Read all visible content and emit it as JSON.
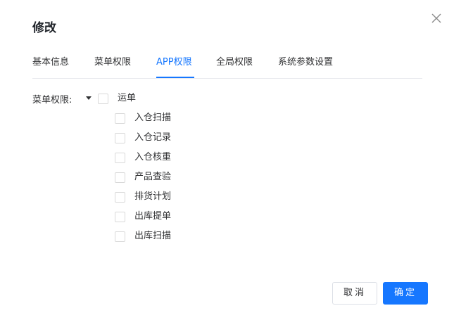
{
  "dialog": {
    "title": "修改"
  },
  "tabs": [
    {
      "label": "基本信息",
      "active": false
    },
    {
      "label": "菜单权限",
      "active": false
    },
    {
      "label": "APP权限",
      "active": true
    },
    {
      "label": "全局权限",
      "active": false
    },
    {
      "label": "系统参数设置",
      "active": false
    }
  ],
  "form": {
    "label": "菜单权限:",
    "tree": {
      "parent": {
        "label": "运单",
        "checked": false,
        "expanded": true
      },
      "children": [
        {
          "label": "入仓扫描",
          "checked": false
        },
        {
          "label": "入仓记录",
          "checked": false
        },
        {
          "label": "入仓核重",
          "checked": false
        },
        {
          "label": "产品查验",
          "checked": false
        },
        {
          "label": "排货计划",
          "checked": false
        },
        {
          "label": "出库提单",
          "checked": false
        },
        {
          "label": "出库扫描",
          "checked": false
        }
      ]
    }
  },
  "footer": {
    "cancel_label": "取消",
    "ok_label": "确定"
  },
  "colors": {
    "accent": "#1677ff",
    "text": "#303133",
    "border": "#d9d9d9"
  },
  "icons": {
    "close": "close-icon",
    "caret": "caret-down-icon"
  }
}
